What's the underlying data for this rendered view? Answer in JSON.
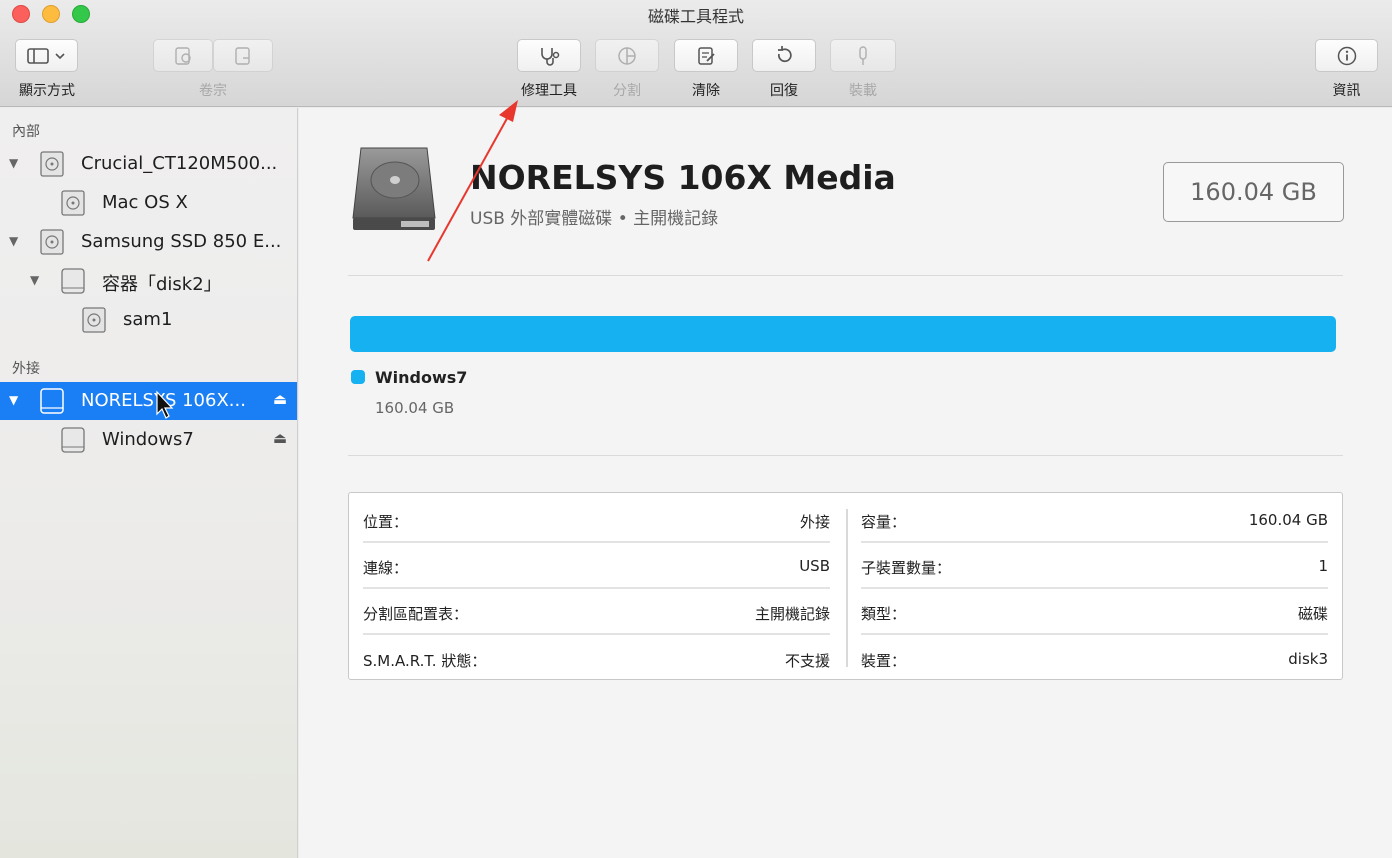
{
  "window": {
    "title": "磁碟工具程式"
  },
  "toolbar": {
    "view_label": "顯示方式",
    "volume_label": "卷宗",
    "firstaid_label": "修理工具",
    "partition_label": "分割",
    "erase_label": "清除",
    "restore_label": "回復",
    "mount_label": "裝載",
    "info_label": "資訊"
  },
  "sidebar": {
    "internal_header": "內部",
    "external_header": "外接",
    "items": [
      {
        "label": "Crucial_CT120M500..."
      },
      {
        "label": "Mac OS X"
      },
      {
        "label": "Samsung SSD 850 E..."
      },
      {
        "label": "容器「disk2」"
      },
      {
        "label": "sam1"
      },
      {
        "label": "NORELSYS 106X...",
        "selected": true
      },
      {
        "label": "Windows7"
      }
    ],
    "eject_glyph": "⏏"
  },
  "drive": {
    "name": "NORELSYS 106X Media",
    "subtitle": "USB 外部實體磁碟 • 主開機記錄",
    "capacity": "160.04 GB"
  },
  "usage": {
    "color": "#15b1f0",
    "volume_name": "Windows7",
    "volume_size": "160.04 GB",
    "fraction_used": 1.0
  },
  "info": {
    "left": [
      {
        "key": "位置：",
        "value": "外接"
      },
      {
        "key": "連線：",
        "value": "USB"
      },
      {
        "key": "分割區配置表：",
        "value": "主開機記錄"
      },
      {
        "key": "S.M.A.R.T. 狀態：",
        "value": "不支援"
      }
    ],
    "right": [
      {
        "key": "容量：",
        "value": "160.04 GB"
      },
      {
        "key": "子裝置數量：",
        "value": "1"
      },
      {
        "key": "類型：",
        "value": "磁碟"
      },
      {
        "key": "裝置：",
        "value": "disk3"
      }
    ]
  },
  "colors": {
    "selection": "#1a7ef5",
    "annotation_arrow": "#e8372d"
  }
}
